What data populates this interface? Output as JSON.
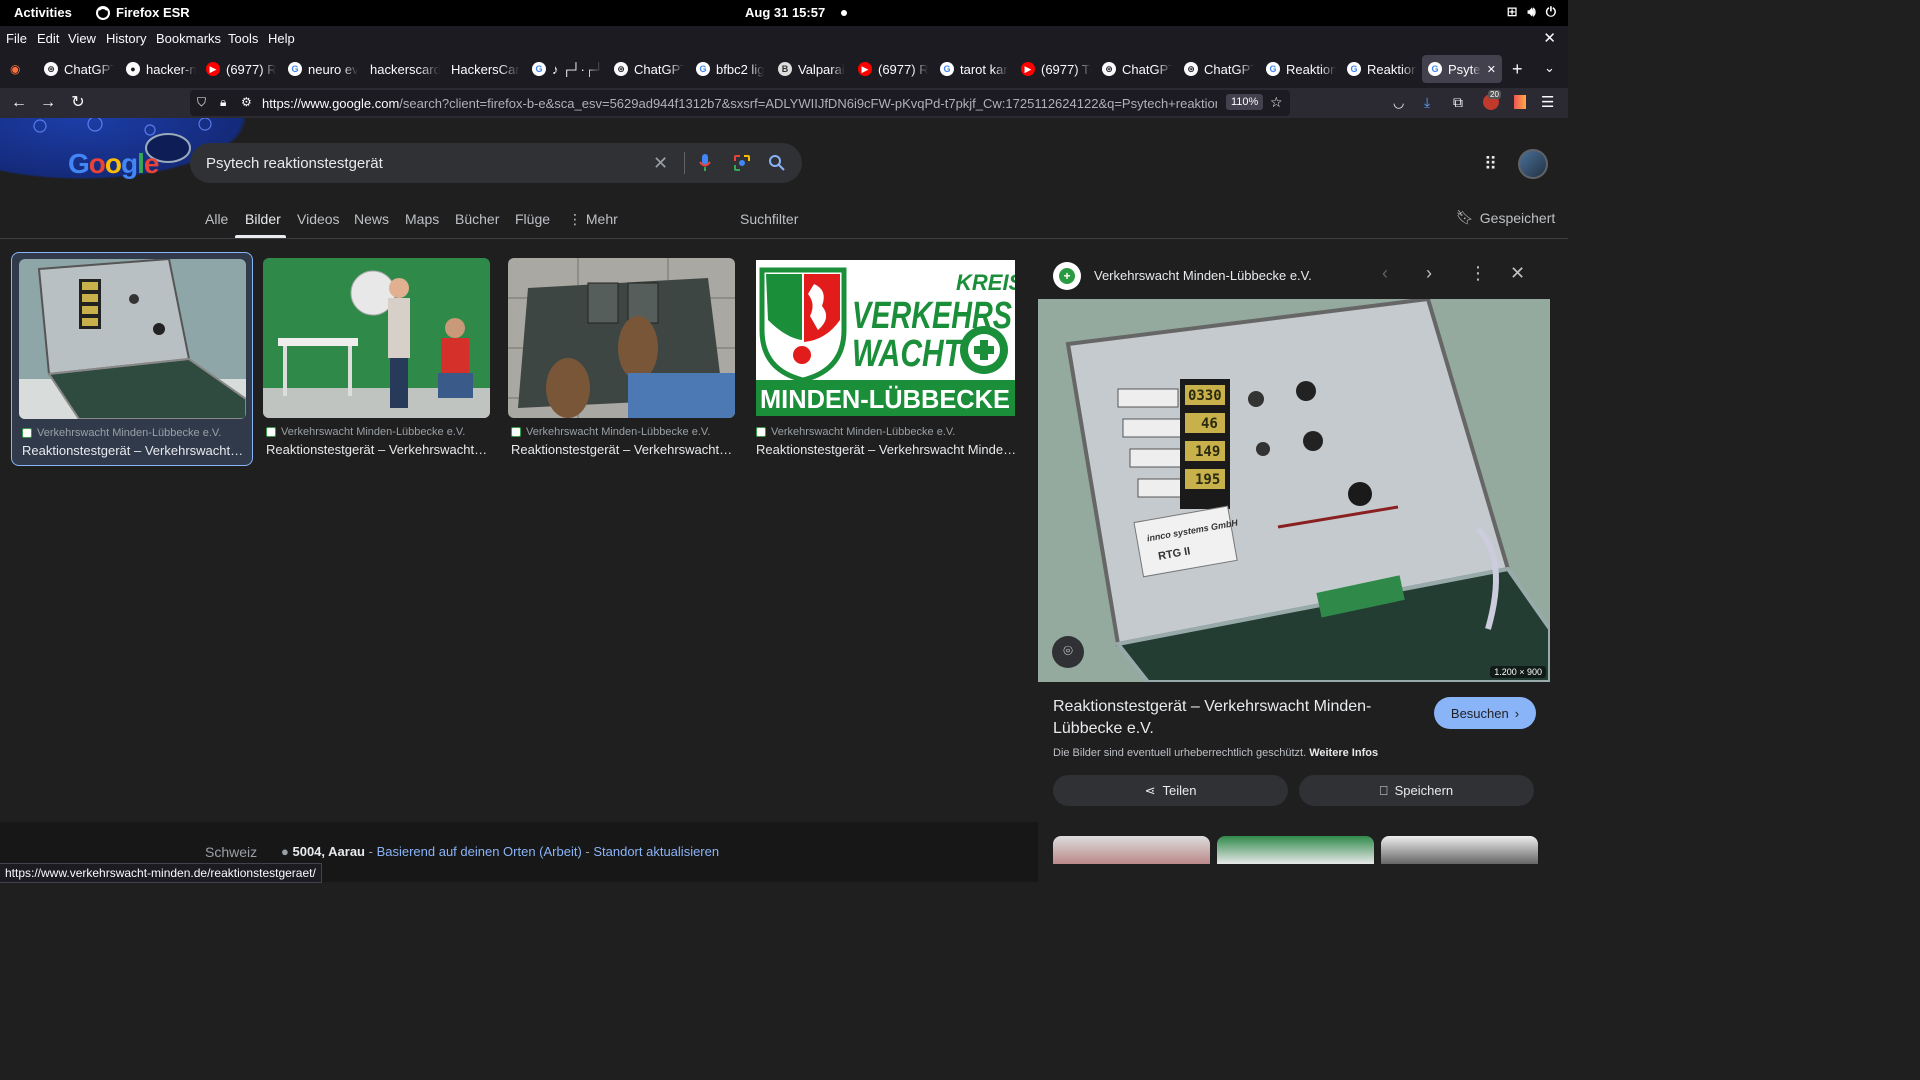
{
  "system_bar": {
    "activities": "Activities",
    "app_name": "Firefox ESR",
    "clock": "Aug 31  15:57"
  },
  "menu": [
    "File",
    "Edit",
    "View",
    "History",
    "Bookmarks",
    "Tools",
    "Help"
  ],
  "tabs": [
    {
      "label": "ChatGPT",
      "icon": "chatgpt-icon"
    },
    {
      "label": "hacker-n",
      "icon": "github-icon"
    },
    {
      "label": "(6977) R",
      "icon": "youtube-icon"
    },
    {
      "label": "neuro ev",
      "icon": "google-icon"
    },
    {
      "label": "hackerscard",
      "icon": "none"
    },
    {
      "label": "HackersCar",
      "icon": "none"
    },
    {
      "label": "♪ ┌┘·┌┘ ♪",
      "icon": "google-icon"
    },
    {
      "label": "ChatGPT",
      "icon": "chatgpt-icon"
    },
    {
      "label": "bfbc2 lig",
      "icon": "google-icon"
    },
    {
      "label": "Valparai",
      "icon": "bf-icon"
    },
    {
      "label": "(6977) R",
      "icon": "youtube-icon"
    },
    {
      "label": "tarot kar",
      "icon": "google-icon"
    },
    {
      "label": "(6977) Ti",
      "icon": "youtube-icon"
    },
    {
      "label": "ChatGPT",
      "icon": "chatgpt-icon"
    },
    {
      "label": "ChatGPT",
      "icon": "chatgpt-icon"
    },
    {
      "label": "Reaktion",
      "icon": "google-icon"
    },
    {
      "label": "Reaktion",
      "icon": "google-icon"
    },
    {
      "label": "Psytec",
      "icon": "google-icon",
      "active": true
    }
  ],
  "nav": {
    "url_host": "https://www.google.com",
    "url_rest": "/search?client=firefox-b-e&sca_esv=5629ad944f1312b7&sxsrf=ADLYWIIJfDN6i9cFW-pKvqPd-t7pkjf_Cw:1725112624122&q=Psytech+reaktionstest",
    "zoom": "110%",
    "extension_badge": "20"
  },
  "search": {
    "query": "Psytech reaktionstestgerät",
    "tabs": [
      "Alle",
      "Bilder",
      "Videos",
      "News",
      "Maps",
      "Bücher",
      "Flüge",
      "Mehr"
    ],
    "selected_tab": "Bilder",
    "filter": "Suchfilter",
    "saved": "Gespeichert"
  },
  "results": [
    {
      "source": "Verkehrswacht Minden-Lübbecke e.V.",
      "title": "Reaktionstestgerät – Verkehrswacht Minden-Lübbecke e.V."
    },
    {
      "source": "Verkehrswacht Minden-Lübbecke e.V.",
      "title": "Reaktionstestgerät – Verkehrswacht Minden-Lübbecke e.V."
    },
    {
      "source": "Verkehrswacht Minden-Lübbecke e.V.",
      "title": "Reaktionstestgerät – Verkehrswacht Minden-Lübbecke e.V."
    },
    {
      "source": "Verkehrswacht Minden-Lübbecke e.V.",
      "title": "Reaktionstestgerät – Verkehrswacht Minden-Lübbecke e.V."
    }
  ],
  "logo_text": {
    "top": "KREIS",
    "mid1": "VERKEHRS",
    "mid2": "WACHT",
    "bottom": "MINDEN-LÜBBECKE"
  },
  "device_readouts": [
    "0330",
    "46",
    "149",
    "195"
  ],
  "device_labels": [
    "innco systems GmbH",
    "RTG II"
  ],
  "panel": {
    "site": "Verkehrswacht Minden-Lübbecke e.V.",
    "image_dims": "1.200 × 900",
    "title": "Reaktionstestgerät – Verkehrswacht Minden-Lübbecke e.V.",
    "visit": "Besuchen",
    "copyright": "Die Bilder sind eventuell urheberrechtlich geschützt.",
    "more_info": "Weitere Infos",
    "share": "Teilen",
    "save": "Speichern"
  },
  "footer": {
    "country": "Schweiz",
    "location": "5004, Aarau",
    "sep1": " - ",
    "based_on": "Basierend auf deinen Orten (Arbeit)",
    "sep2": " - ",
    "update": "Standort aktualisieren"
  },
  "status_url": "https://www.verkehrswacht-minden.de/reaktionstestgeraet/",
  "colors": {
    "accent": "#8ab4f8",
    "verkehrswacht_green": "#2a9a40",
    "page_bg": "#1f1f1f"
  }
}
